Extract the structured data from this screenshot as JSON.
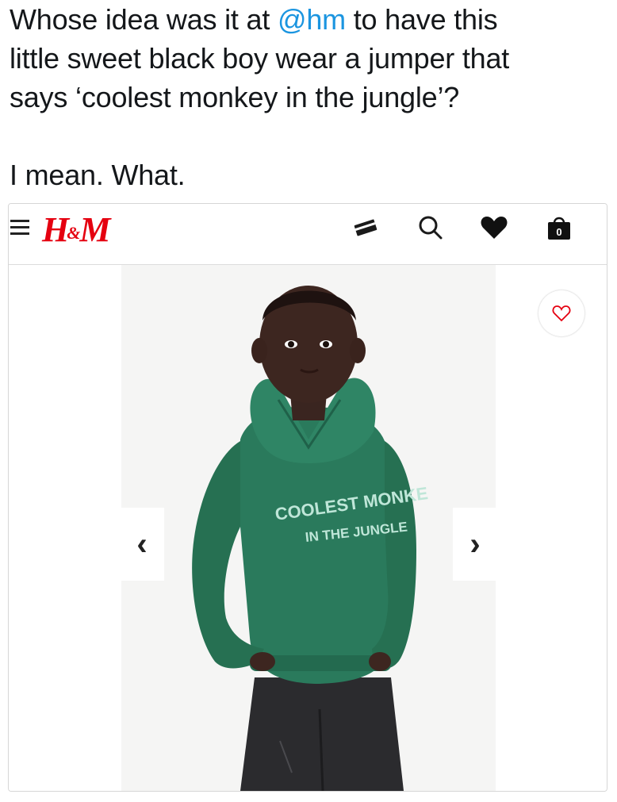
{
  "tweet": {
    "line1_pre": "Whose idea was it at ",
    "mention": "@hm",
    "line1_post": " to have this",
    "line2": "little sweet black boy wear a jumper that",
    "line3": "says ‘coolest monkey in the jungle’?",
    "line4": "I mean. What."
  },
  "header": {
    "logo_text": "H&M",
    "logo_color": "#e50010",
    "icons": [
      "menu-icon",
      "card-icon",
      "search-icon",
      "heart-icon",
      "shopping-bag-icon"
    ],
    "bag_count": "0"
  },
  "product": {
    "prev_arrow": "‹",
    "next_arrow": "›",
    "favorite_icon": "heart-outline-icon",
    "hoodie_color": "#2a7a5c",
    "print_line1": "COOLEST MONKE",
    "print_line2": "IN THE JUNGLE"
  }
}
